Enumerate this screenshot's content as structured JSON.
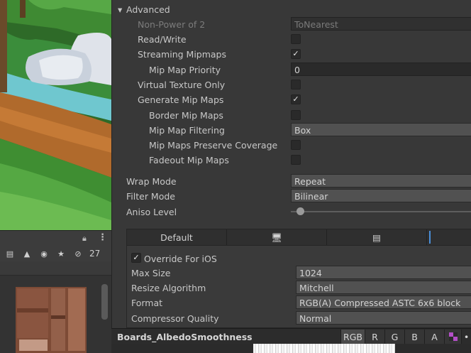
{
  "inspector": {
    "section_title": "Advanced",
    "non_power_of_2": {
      "label": "Non-Power of 2",
      "value": "ToNearest"
    },
    "read_write": {
      "label": "Read/Write",
      "checked": false
    },
    "streaming_mipmaps": {
      "label": "Streaming Mipmaps",
      "checked": true
    },
    "mip_map_priority": {
      "label": "Mip Map Priority",
      "value": "0"
    },
    "virtual_texture_only": {
      "label": "Virtual Texture Only",
      "checked": false
    },
    "generate_mip_maps": {
      "label": "Generate Mip Maps",
      "checked": true
    },
    "border_mip_maps": {
      "label": "Border Mip Maps",
      "checked": false
    },
    "mip_map_filtering": {
      "label": "Mip Map Filtering",
      "value": "Box"
    },
    "mip_maps_preserve_coverage": {
      "label": "Mip Maps Preserve Coverage",
      "checked": false
    },
    "fadeout_mip_maps": {
      "label": "Fadeout Mip Maps",
      "checked": false
    },
    "wrap_mode": {
      "label": "Wrap Mode",
      "value": "Repeat"
    },
    "filter_mode": {
      "label": "Filter Mode",
      "value": "Bilinear"
    },
    "aniso_level": {
      "label": "Aniso Level",
      "slider_fraction": 0.05
    }
  },
  "platform": {
    "tabs": [
      {
        "label": "Default",
        "icon": ""
      },
      {
        "label": "",
        "icon": "monitor-icon"
      },
      {
        "label": "",
        "icon": "server-icon"
      }
    ],
    "override": {
      "label": "Override For iOS",
      "checked": true
    },
    "max_size": {
      "label": "Max Size",
      "value": "1024"
    },
    "resize_algorithm": {
      "label": "Resize Algorithm",
      "value": "Mitchell"
    },
    "format": {
      "label": "Format",
      "value": "RGB(A) Compressed ASTC 6x6 block"
    },
    "compressor_quality": {
      "label": "Compressor Quality",
      "value": "Normal"
    }
  },
  "preview_bar": {
    "asset_name": "Boards_AlbedoSmoothness",
    "channels": [
      "RGB",
      "R",
      "G",
      "B",
      "A"
    ]
  },
  "left_toolbar": {
    "count": "27"
  },
  "colors": {
    "panel_bg": "#383838",
    "field_bg": "#2a2a2a",
    "dropdown_bg": "#515151",
    "accent_blue": "#4a8fd8"
  }
}
